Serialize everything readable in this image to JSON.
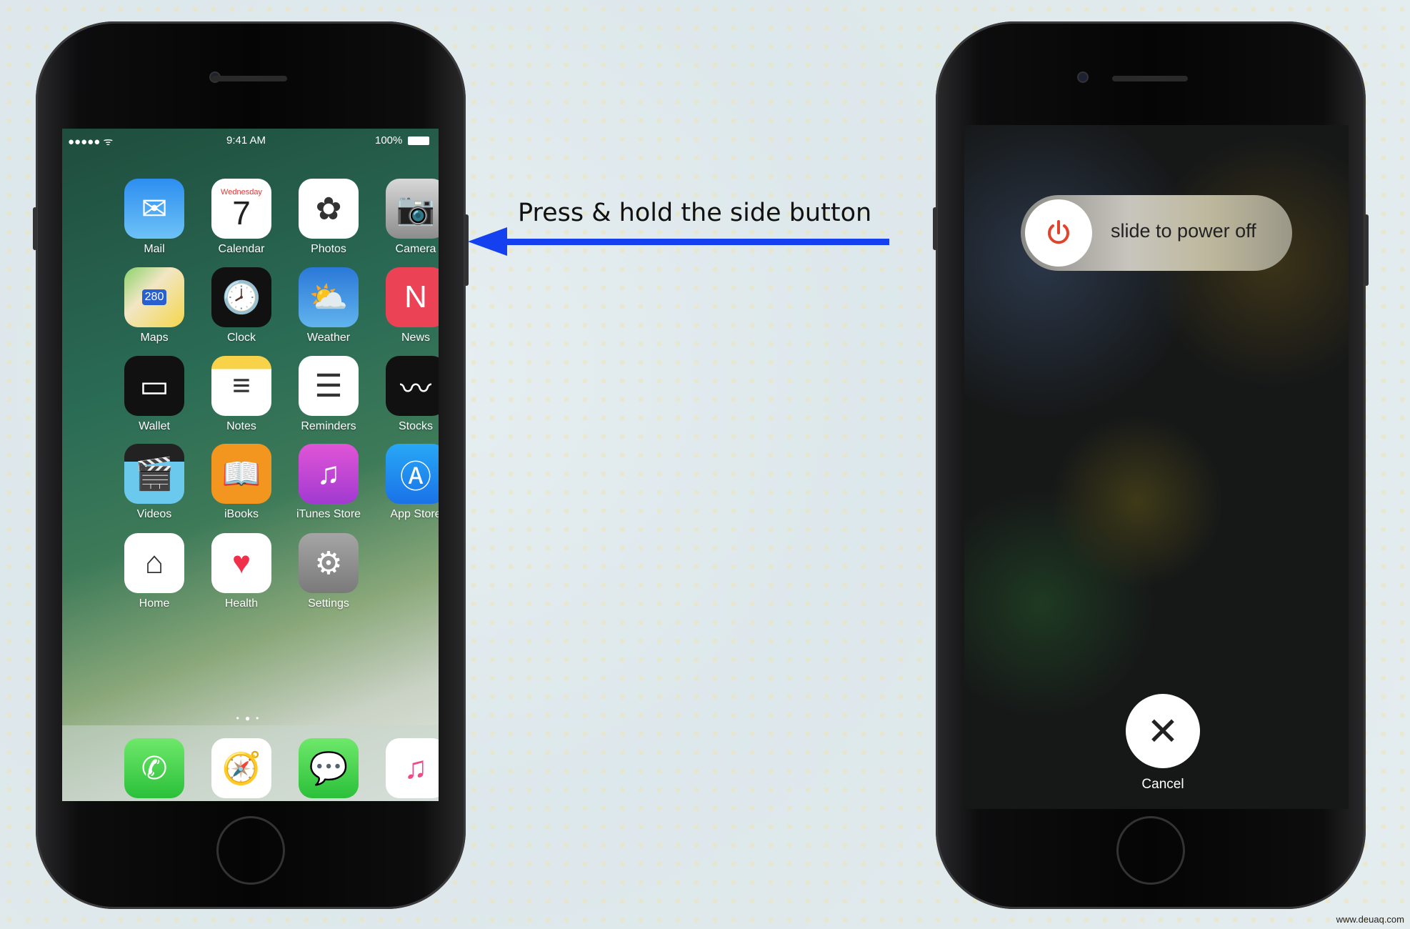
{
  "instruction": "Press & hold the side button",
  "colors": {
    "arrow": "#1440f0",
    "power_icon": "#e0452b"
  },
  "left_phone": {
    "status": {
      "signal": "●●●●● ᯤ",
      "time": "9:41 AM",
      "battery": "100%"
    },
    "apps": [
      {
        "label": "Mail",
        "icon": "mail-icon",
        "glyph": "✉",
        "bg": "linear-gradient(#2d8ef0,#6dc2f6)"
      },
      {
        "label": "Calendar",
        "icon": "calendar-icon",
        "glyph": "7",
        "sub": "Wednesday",
        "bg": "#ffffff"
      },
      {
        "label": "Photos",
        "icon": "photos-icon",
        "glyph": "✿",
        "bg": "#ffffff"
      },
      {
        "label": "Camera",
        "icon": "camera-icon",
        "glyph": "📷",
        "bg": "linear-gradient(#d8d8d8,#8c8c8c)"
      },
      {
        "label": "Maps",
        "icon": "maps-icon",
        "glyph": "280",
        "bg": "linear-gradient(135deg,#8bd36b,#f2e6c4 40%,#f4d64a)"
      },
      {
        "label": "Clock",
        "icon": "clock-icon",
        "glyph": "🕗",
        "bg": "#111111"
      },
      {
        "label": "Weather",
        "icon": "weather-icon",
        "glyph": "⛅",
        "bg": "linear-gradient(#2a78d8,#62b4ee)"
      },
      {
        "label": "News",
        "icon": "news-icon",
        "glyph": "N",
        "bg": "#ec4256"
      },
      {
        "label": "Wallet",
        "icon": "wallet-icon",
        "glyph": "▭",
        "bg": "#111111"
      },
      {
        "label": "Notes",
        "icon": "notes-icon",
        "glyph": "≡",
        "bg": "linear-gradient(#f8d34a 22%,#ffffff 22%)"
      },
      {
        "label": "Reminders",
        "icon": "reminders-icon",
        "glyph": "☰",
        "bg": "#ffffff"
      },
      {
        "label": "Stocks",
        "icon": "stocks-icon",
        "glyph": "〰",
        "bg": "#111111"
      },
      {
        "label": "Videos",
        "icon": "videos-icon",
        "glyph": "🎬",
        "bg": "linear-gradient(#222 30%,#6cc9ee 30%)"
      },
      {
        "label": "iBooks",
        "icon": "ibooks-icon",
        "glyph": "📖",
        "bg": "#f3961f"
      },
      {
        "label": "iTunes Store",
        "icon": "itunes-store-icon",
        "glyph": "♫",
        "bg": "linear-gradient(#e155d6,#a13ad1)"
      },
      {
        "label": "App Store",
        "icon": "app-store-icon",
        "glyph": "Ⓐ",
        "bg": "linear-gradient(#27a8f6,#1b72e8)"
      },
      {
        "label": "Home",
        "icon": "home-icon",
        "glyph": "⌂",
        "bg": "#ffffff"
      },
      {
        "label": "Health",
        "icon": "health-icon",
        "glyph": "♥",
        "bg": "#ffffff"
      },
      {
        "label": "Settings",
        "icon": "settings-icon",
        "glyph": "⚙",
        "bg": "linear-gradient(#a5a5a5,#7a7a7a)"
      }
    ],
    "dock": [
      {
        "label": "Phone",
        "icon": "phone-icon",
        "glyph": "✆",
        "bg": "linear-gradient(#6ee86a,#2bc03a)"
      },
      {
        "label": "Safari",
        "icon": "safari-icon",
        "glyph": "🧭",
        "bg": "#ffffff"
      },
      {
        "label": "Messages",
        "icon": "messages-icon",
        "glyph": "💬",
        "bg": "linear-gradient(#6ee86a,#2bc03a)"
      },
      {
        "label": "Music",
        "icon": "music-icon",
        "glyph": "♫",
        "bg": "#ffffff"
      }
    ]
  },
  "right_phone": {
    "slider_label": "slide to power off",
    "cancel_label": "Cancel"
  },
  "watermark": "www.deuaq.com"
}
